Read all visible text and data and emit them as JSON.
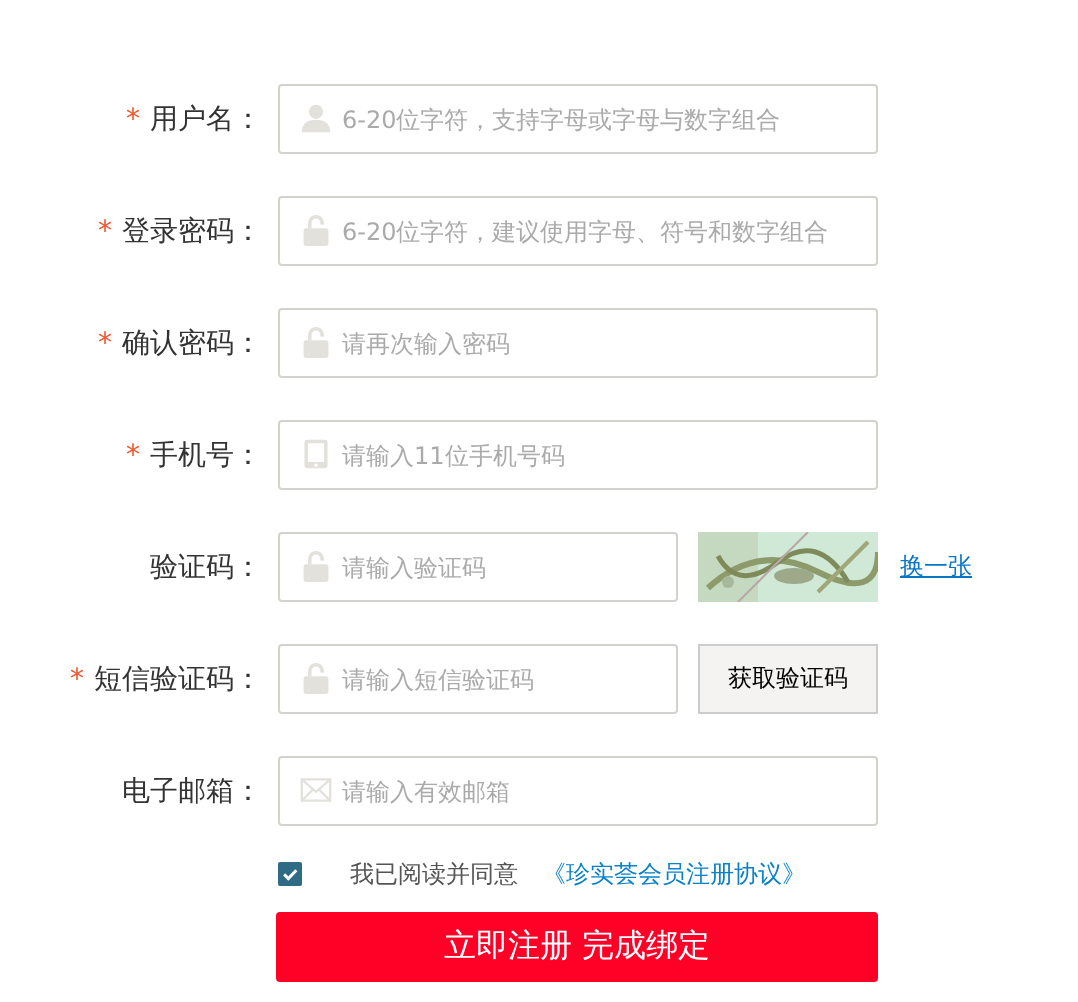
{
  "fields": [
    {
      "kind": "user",
      "required_mark": "*",
      "label": "用户名：",
      "placeholder": "6-20位字符，支持字母或字母与数字组合"
    },
    {
      "kind": "password",
      "required_mark": "*",
      "label": "登录密码：",
      "placeholder": "6-20位字符，建议使用字母、符号和数字组合"
    },
    {
      "kind": "password",
      "required_mark": "*",
      "label": "确认密码：",
      "placeholder": "请再次输入密码"
    },
    {
      "kind": "phone",
      "required_mark": "*",
      "label": "手机号：",
      "placeholder": "请输入11位手机号码"
    },
    {
      "kind": "captcha",
      "label": "验证码：",
      "placeholder": "请输入验证码",
      "link": "换一张"
    },
    {
      "kind": "sms",
      "required_mark": "*",
      "label": "短信验证码：",
      "placeholder": "请输入短信验证码",
      "button": "获取验证码"
    },
    {
      "kind": "email",
      "label": "电子邮箱：",
      "placeholder": "请输入有效邮箱"
    }
  ],
  "agreement": {
    "checked": true,
    "text": "我已阅读并同意",
    "link": "《珍实荟会员注册协议》"
  },
  "submit": "立即注册 完成绑定"
}
